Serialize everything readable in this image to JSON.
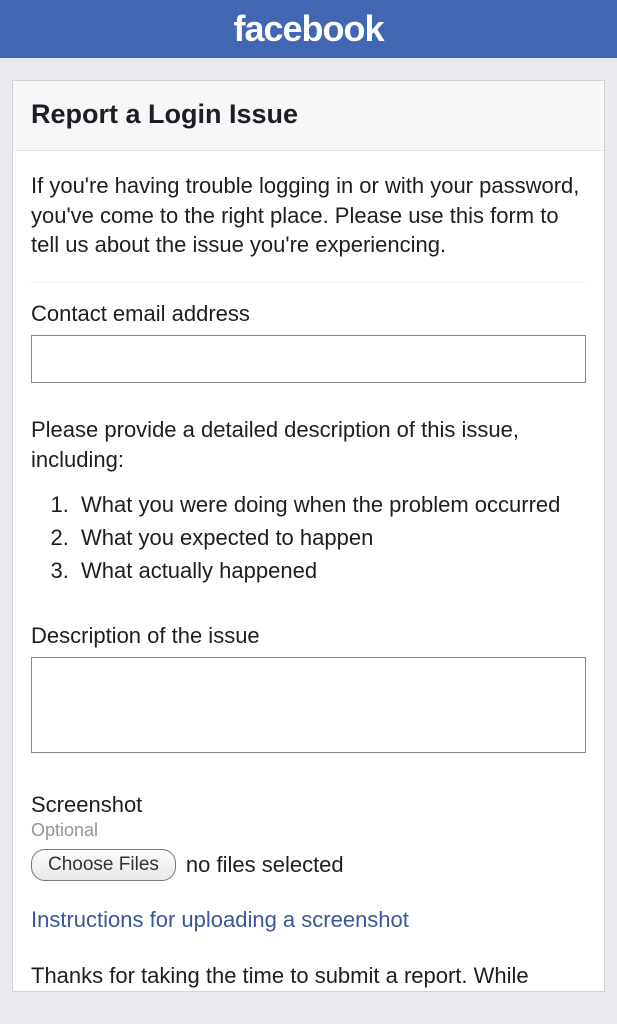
{
  "header": {
    "logo": "facebook"
  },
  "page": {
    "title": "Report a Login Issue",
    "intro": "If you're having trouble logging in or with your password, you've come to the right place. Please use this form to tell us about the issue you're experiencing.",
    "email_label": "Contact email address",
    "email_value": "",
    "desc_prompt": "Please provide a detailed description of this issue, including:",
    "desc_items": [
      "What you were doing when the problem occurred",
      "What you expected to happen",
      "What actually happened"
    ],
    "description_label": "Description of the issue",
    "description_value": "",
    "screenshot_label": "Screenshot",
    "optional_label": "Optional",
    "file_button": "Choose Files",
    "file_status": "no files selected",
    "instructions_link": "Instructions for uploading a screenshot",
    "thanks_text": "Thanks for taking the time to submit a report. While"
  }
}
